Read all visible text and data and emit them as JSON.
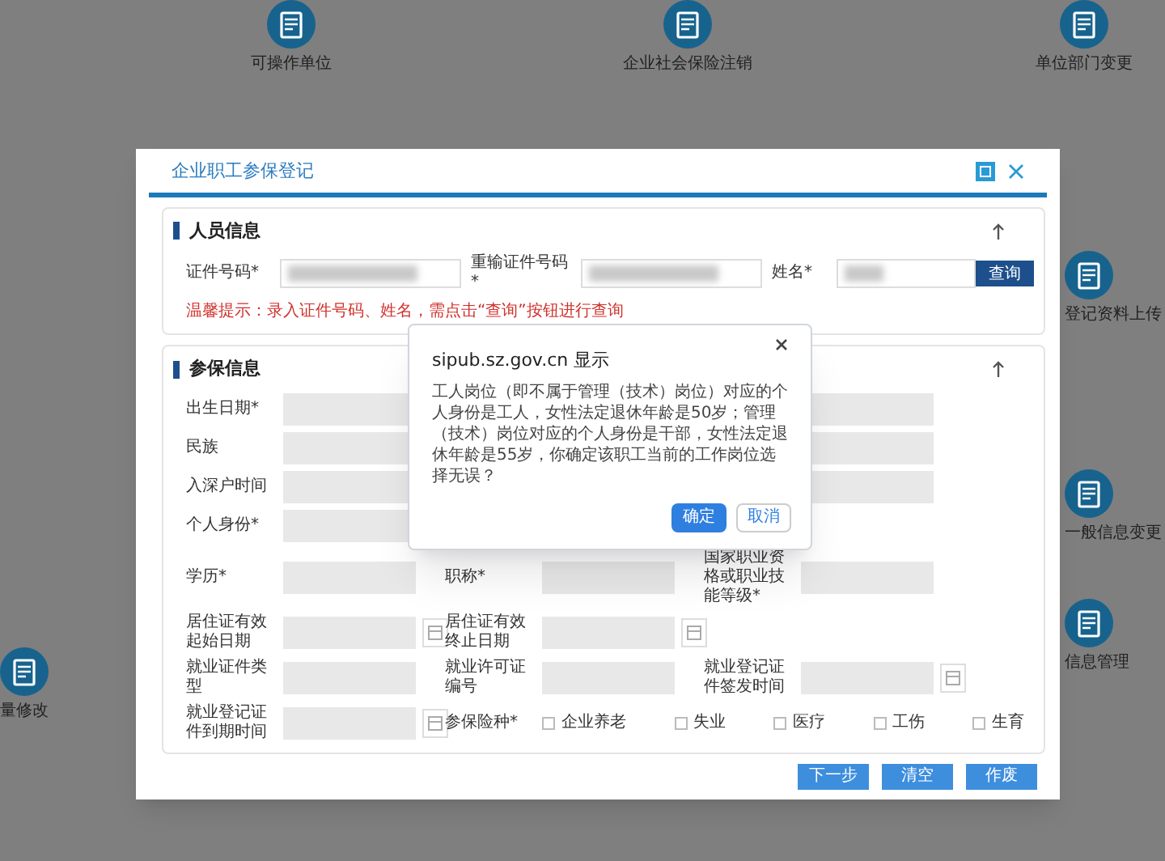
{
  "background": {
    "tiles": [
      {
        "label": "可操作单位"
      },
      {
        "label": "企业社会保险注销"
      },
      {
        "label": "单位部门变更"
      },
      {
        "label": "登记资料上传"
      },
      {
        "label": "一般信息变更"
      },
      {
        "label": "信息管理"
      },
      {
        "label": "量修改"
      }
    ]
  },
  "modal": {
    "title": "企业职工参保登记",
    "person_section": {
      "title": "人员信息",
      "fields": [
        {
          "label": "证件号码*"
        },
        {
          "label": "重输证件号码*"
        },
        {
          "label": "姓名*"
        }
      ],
      "query_button": "查询",
      "hint": "温馨提示：录入证件号码、姓名，需点击“查询”按钮进行查询"
    },
    "insurance_section": {
      "title": "参保信息",
      "rows": [
        [
          {
            "kind": "field",
            "label": "出生日期*"
          },
          {
            "kind": "blank"
          },
          {
            "kind": "field"
          }
        ],
        [
          {
            "kind": "field",
            "label": "民族"
          },
          {
            "kind": "blank"
          },
          {
            "kind": "field"
          }
        ],
        [
          {
            "kind": "field",
            "label": "入深户时间"
          },
          {
            "kind": "blank"
          },
          {
            "kind": "field"
          }
        ],
        [
          {
            "kind": "field",
            "label": "个人身份*"
          },
          {
            "kind": "blank"
          },
          {
            "kind": "blank"
          }
        ],
        [
          {
            "kind": "field",
            "label": "学历*"
          },
          {
            "kind": "field",
            "label": "职称*"
          },
          {
            "kind": "field",
            "label": "国家职业资格或职业技能等级*"
          }
        ],
        [
          {
            "kind": "date",
            "label": "居住证有效起始日期"
          },
          {
            "kind": "date",
            "label": "居住证有效终止日期"
          },
          {
            "kind": "blank"
          }
        ],
        [
          {
            "kind": "field",
            "label": "就业证件类型"
          },
          {
            "kind": "field",
            "label": "就业许可证编号"
          },
          {
            "kind": "date",
            "label": "就业登记证件签发时间"
          }
        ],
        [
          {
            "kind": "date",
            "label": "就业登记证件到期时间"
          },
          {
            "kind": "checks",
            "label": "参保险种*",
            "options": [
              {
                "label": "企业养老",
                "checked": false
              },
              {
                "label": "失业",
                "checked": false
              },
              {
                "label": "医疗",
                "checked": false
              },
              {
                "label": "工伤",
                "checked": false
              },
              {
                "label": "生育",
                "checked": false
              }
            ]
          }
        ]
      ]
    },
    "buttons": [
      "下一步",
      "清空",
      "作废"
    ]
  },
  "alert": {
    "title": "sipub.sz.gov.cn 显示",
    "message": "工人岗位（即不属于管理（技术）岗位）对应的个人身份是工人，女性法定退休年龄是50岁；管理（技术）岗位对应的个人身份是干部，女性法定退休年龄是55岁，你确定该职工当前的工作岗位选择无误？",
    "buttons": [
      {
        "label": "确定",
        "primary": true
      },
      {
        "label": "取消",
        "primary": false
      }
    ]
  }
}
